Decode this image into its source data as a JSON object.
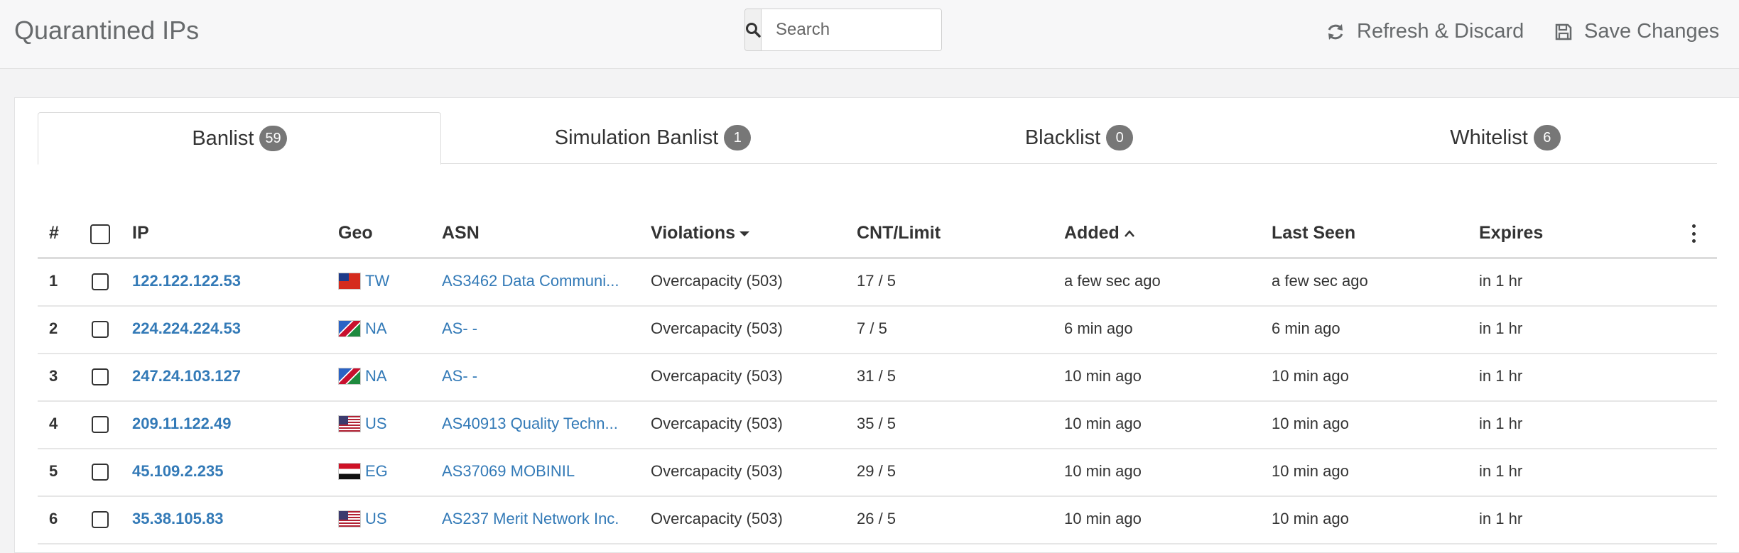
{
  "header": {
    "title": "Quarantined IPs",
    "search_placeholder": "Search",
    "refresh_label": "Refresh & Discard",
    "save_label": "Save Changes"
  },
  "tabs": [
    {
      "label": "Banlist",
      "count": "59",
      "active": true
    },
    {
      "label": "Simulation Banlist",
      "count": "1",
      "active": false
    },
    {
      "label": "Blacklist",
      "count": "0",
      "active": false
    },
    {
      "label": "Whitelist",
      "count": "6",
      "active": false
    }
  ],
  "table": {
    "columns": {
      "num": "#",
      "ip": "IP",
      "geo": "Geo",
      "asn": "ASN",
      "violations": "Violations",
      "cnt": "CNT/Limit",
      "added": "Added",
      "last_seen": "Last Seen",
      "expires": "Expires"
    },
    "rows": [
      {
        "num": "1",
        "ip": "122.122.122.53",
        "flag": "tw",
        "geo": "TW",
        "asn": "AS3462 Data Communi...",
        "violations": "Overcapacity (503)",
        "cnt": "17 / 5",
        "added": "a few sec ago",
        "last_seen": "a few sec ago",
        "expires": "in 1 hr"
      },
      {
        "num": "2",
        "ip": "224.224.224.53",
        "flag": "na",
        "geo": "NA",
        "asn": "AS- -",
        "violations": "Overcapacity (503)",
        "cnt": "7 / 5",
        "added": "6 min ago",
        "last_seen": "6 min ago",
        "expires": "in 1 hr"
      },
      {
        "num": "3",
        "ip": "247.24.103.127",
        "flag": "na",
        "geo": "NA",
        "asn": "AS- -",
        "violations": "Overcapacity (503)",
        "cnt": "31 / 5",
        "added": "10 min ago",
        "last_seen": "10 min ago",
        "expires": "in 1 hr"
      },
      {
        "num": "4",
        "ip": "209.11.122.49",
        "flag": "us",
        "geo": "US",
        "asn": "AS40913 Quality Techn...",
        "violations": "Overcapacity (503)",
        "cnt": "35 / 5",
        "added": "10 min ago",
        "last_seen": "10 min ago",
        "expires": "in 1 hr"
      },
      {
        "num": "5",
        "ip": "45.109.2.235",
        "flag": "eg",
        "geo": "EG",
        "asn": "AS37069 MOBINIL",
        "violations": "Overcapacity (503)",
        "cnt": "29 / 5",
        "added": "10 min ago",
        "last_seen": "10 min ago",
        "expires": "in 1 hr"
      },
      {
        "num": "6",
        "ip": "35.38.105.83",
        "flag": "us",
        "geo": "US",
        "asn": "AS237 Merit Network Inc.",
        "violations": "Overcapacity (503)",
        "cnt": "26 / 5",
        "added": "10 min ago",
        "last_seen": "10 min ago",
        "expires": "in 1 hr"
      }
    ]
  }
}
